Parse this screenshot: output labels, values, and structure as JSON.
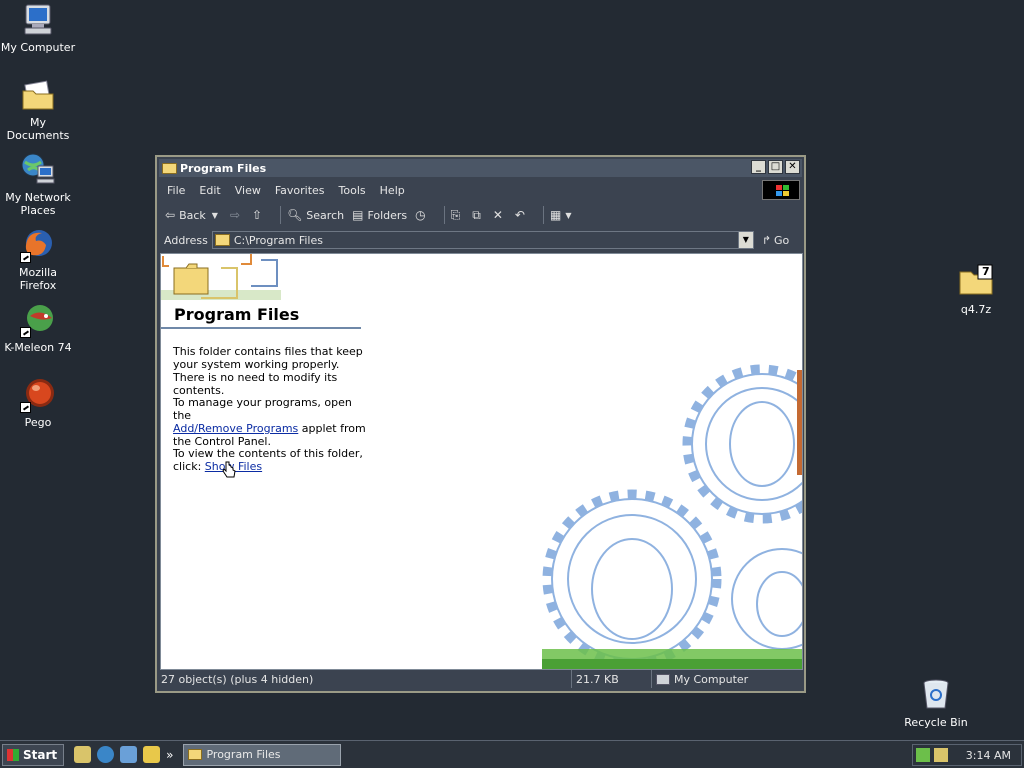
{
  "desktop": {
    "icons_left": [
      {
        "label": "My Computer",
        "icon": "computer-icon"
      },
      {
        "label": "My Documents",
        "icon": "documents-folder-icon"
      },
      {
        "label": "My Network Places",
        "icon": "network-places-icon"
      },
      {
        "label": "Mozilla Firefox",
        "icon": "firefox-icon"
      },
      {
        "label": "K-Meleon 74",
        "icon": "k-meleon-icon"
      },
      {
        "label": "Pego",
        "icon": "pego-icon"
      }
    ],
    "icon_right": {
      "label": "q4.7z",
      "icon": "7z-archive-icon",
      "badge": "7"
    },
    "recycle_bin": {
      "label": "Recycle Bin",
      "icon": "recycle-bin-icon"
    }
  },
  "window": {
    "title": "Program Files",
    "controls": {
      "minimize": "_",
      "maximize": "□",
      "close": "✕"
    },
    "menu": [
      "File",
      "Edit",
      "View",
      "Favorites",
      "Tools",
      "Help"
    ],
    "toolbar": {
      "back": "Back",
      "search": "Search",
      "folders": "Folders"
    },
    "address": {
      "label": "Address",
      "value": "C:\\Program Files",
      "go": "Go"
    },
    "panel": {
      "heading": "Program Files",
      "para1": "This folder contains files that keep your system working properly. There is no need to modify its contents.",
      "para2_prefix": "To manage your programs, open the",
      "para2_link": "Add/Remove Programs",
      "para2_suffix": " applet from the Control Panel.",
      "para3_prefix": "To view the contents of this folder, click: ",
      "para3_link": "Show Files"
    },
    "status": {
      "objects": "27 object(s) (plus 4 hidden)",
      "size": "21.7 KB",
      "location": "My Computer"
    }
  },
  "taskbar": {
    "start": "Start",
    "chevron": "»",
    "active_task": "Program Files",
    "clock": "3:14 AM"
  },
  "colors": {
    "desktop_bg": "#232a33",
    "window_frame": "#3b4350",
    "link": "#0b2ca3",
    "folder": "#f3d77a"
  }
}
